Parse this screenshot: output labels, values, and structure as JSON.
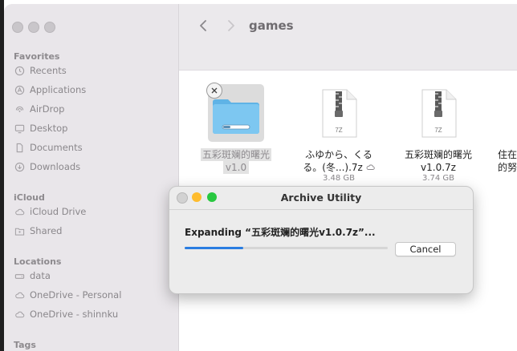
{
  "window": {
    "folder_title": "games"
  },
  "sidebar": {
    "sections": {
      "favorites": "Favorites",
      "icloud": "iCloud",
      "locations": "Locations",
      "tags": "Tags"
    },
    "favorites": [
      {
        "label": "Recents",
        "icon": "clock-icon"
      },
      {
        "label": "Applications",
        "icon": "applications-icon"
      },
      {
        "label": "AirDrop",
        "icon": "airdrop-icon"
      },
      {
        "label": "Desktop",
        "icon": "desktop-icon"
      },
      {
        "label": "Documents",
        "icon": "document-icon"
      },
      {
        "label": "Downloads",
        "icon": "download-icon"
      }
    ],
    "icloud": [
      {
        "label": "iCloud Drive",
        "icon": "cloud-icon"
      },
      {
        "label": "Shared",
        "icon": "shared-folder-icon"
      }
    ],
    "locations": [
      {
        "label": "data",
        "icon": "drive-icon"
      },
      {
        "label": "OneDrive - Personal",
        "icon": "cloud-icon"
      },
      {
        "label": "OneDrive - shinnku",
        "icon": "cloud-icon"
      }
    ]
  },
  "files": [
    {
      "name_line1": "五彩斑斓的曙光",
      "name_line2": "v1.0",
      "size": "",
      "type": "folder"
    },
    {
      "name_line1": "ふゆから、くる",
      "name_line2": "る。(冬...).7z",
      "size": "3.48 GB",
      "type": "7z"
    },
    {
      "name_line1": "五彩斑斓的曙光",
      "name_line2": "v1.0.7z",
      "size": "3.74 GB",
      "type": "7z"
    },
    {
      "name_line1": "住在",
      "name_line2": "的努",
      "size": "",
      "type": "partial"
    }
  ],
  "archive_badge": "7Z",
  "dialog": {
    "title": "Archive Utility",
    "message": "Expanding “五彩斑斓的曙光v1.0.7z”...",
    "cancel_label": "Cancel",
    "progress_percent": 29
  },
  "colors": {
    "accent": "#2a7de1",
    "traffic_red": "#fe5f57",
    "traffic_yellow": "#febc2e",
    "traffic_green": "#28c840",
    "folder_blue": "#6fc0ec"
  }
}
